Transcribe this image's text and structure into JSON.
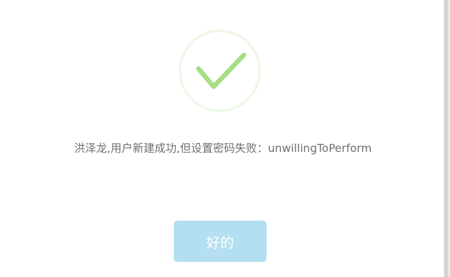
{
  "dialog": {
    "icon": "success-checkmark-icon",
    "icon_colors": {
      "ring": "#eef8e8",
      "check": "#a6de86"
    },
    "message": "洪泽龙,用户新建成功,但设置密码失败：unwillingToPerform",
    "ok_label": "好的",
    "ok_color": "#b4dff0"
  }
}
